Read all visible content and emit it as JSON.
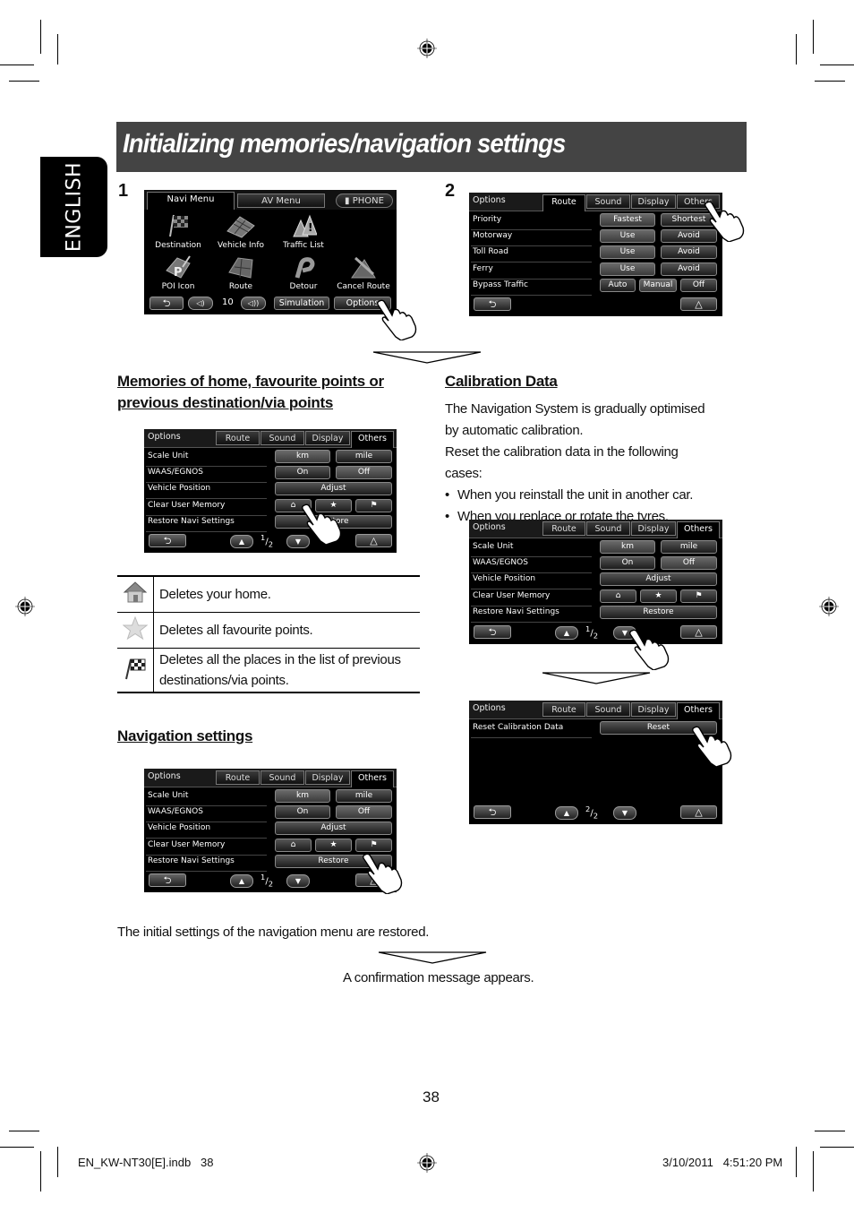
{
  "language_tab": "ENGLISH",
  "title": "Initializing memories/navigation settings",
  "steps": [
    "1",
    "2"
  ],
  "screen_navi_menu": {
    "tabs": [
      "Navi Menu",
      "AV Menu",
      "PHONE"
    ],
    "icons": [
      "Destination",
      "Vehicle Info",
      "Traffic List",
      "POI Icon",
      "Route",
      "Detour",
      "Cancel Route"
    ],
    "volume_value": "10",
    "buttons": {
      "simulation": "Simulation",
      "options": "Options"
    }
  },
  "screen_route": {
    "header": "Options",
    "tabs": [
      "Route",
      "Sound",
      "Display",
      "Others"
    ],
    "active_tab": "Route",
    "rows": [
      {
        "label": "Priority",
        "options": [
          "Fastest",
          "Shortest"
        ]
      },
      {
        "label": "Motorway",
        "options": [
          "Use",
          "Avoid"
        ]
      },
      {
        "label": "Toll Road",
        "options": [
          "Use",
          "Avoid"
        ]
      },
      {
        "label": "Ferry",
        "options": [
          "Use",
          "Avoid"
        ]
      },
      {
        "label": "Bypass Traffic",
        "options": [
          "Auto",
          "Manual",
          "Off"
        ]
      }
    ]
  },
  "screen_others_p1": {
    "header": "Options",
    "tabs": [
      "Route",
      "Sound",
      "Display",
      "Others"
    ],
    "active_tab": "Others",
    "rows": [
      {
        "label": "Scale Unit",
        "options": [
          "km",
          "mile"
        ]
      },
      {
        "label": "WAAS/EGNOS",
        "options": [
          "On",
          "Off"
        ]
      },
      {
        "label": "Vehicle Position",
        "options": [
          "Adjust"
        ]
      },
      {
        "label": "Clear User Memory",
        "options": [
          "home-icon",
          "star-icon",
          "flag-icon"
        ]
      },
      {
        "label": "Restore Navi Settings",
        "options": [
          "Restore"
        ]
      }
    ],
    "page_current": "1",
    "page_total": "2"
  },
  "screen_others_p2": {
    "header": "Options",
    "tabs": [
      "Route",
      "Sound",
      "Display",
      "Others"
    ],
    "active_tab": "Others",
    "rows": [
      {
        "label": "Reset Calibration Data",
        "options": [
          "Reset"
        ]
      }
    ],
    "page_current": "2",
    "page_total": "2"
  },
  "memories_section": {
    "heading_line1": "Memories of home, favourite points or",
    "heading_line2": "previous destination/via points",
    "table": [
      {
        "icon": "home-icon",
        "text": "Deletes your home."
      },
      {
        "icon": "star-icon",
        "text": "Deletes all favourite points."
      },
      {
        "icon": "flag-icon",
        "text": "Deletes all the places in the list of previous destinations/via points."
      }
    ]
  },
  "navigation_section": {
    "heading": "Navigation settings",
    "result_text": "The initial settings of the navigation menu are restored.",
    "confirmation_text": "A confirmation message appears."
  },
  "calibration_section": {
    "heading": "Calibration Data",
    "paragraph1": "The Navigation System is gradually optimised by automatic calibration.",
    "paragraph2": "Reset the calibration data in the following cases:",
    "bullets": [
      "When you reinstall the unit in another car.",
      "When you replace or rotate the tyres."
    ]
  },
  "page_number": "38",
  "footer": {
    "left": "EN_KW-NT30[E].indb   38",
    "right": "3/10/2011   4:51:20 PM"
  }
}
